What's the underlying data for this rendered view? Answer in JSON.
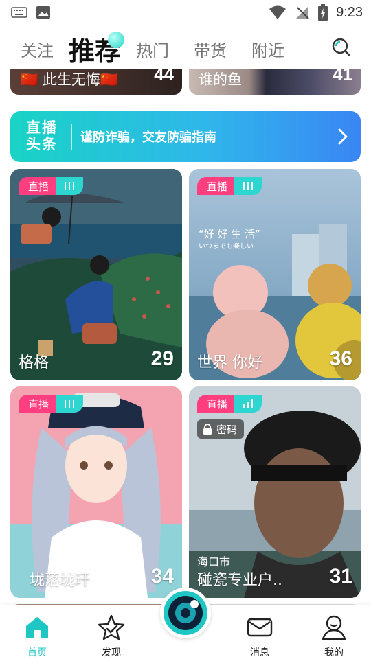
{
  "status_bar": {
    "time": "9:23"
  },
  "top_nav": {
    "tabs": [
      {
        "label": "关注",
        "active": false
      },
      {
        "label": "推荐",
        "active": true
      },
      {
        "label": "热门",
        "active": false
      },
      {
        "label": "带货",
        "active": false
      },
      {
        "label": "附近",
        "active": false
      }
    ]
  },
  "partial_cards": [
    {
      "label": "🇨🇳 此生无悔🇨🇳",
      "count": "44"
    },
    {
      "label": "谁的鱼",
      "count": "41"
    }
  ],
  "banner": {
    "logo_line1": "直播",
    "logo_line2": "头条",
    "text": "谨防诈骗，交友防骗指南"
  },
  "live_badge_label": "直播",
  "cards": [
    {
      "name": "格格",
      "viewers": "29"
    },
    {
      "name": "世界 你好",
      "viewers": "36"
    },
    {
      "name": "垅落垅玕",
      "viewers": "34"
    },
    {
      "name": "碰瓷专业户..",
      "viewers": "31",
      "city": "海口市",
      "lock_label": "密码"
    }
  ],
  "bottom_nav": [
    {
      "label": "首页",
      "icon": "home-icon",
      "active": true
    },
    {
      "label": "发现",
      "icon": "star-icon",
      "active": false
    },
    {
      "label": "",
      "icon": "camera-lens-icon",
      "active": false
    },
    {
      "label": "消息",
      "icon": "mail-icon",
      "active": false
    },
    {
      "label": "我的",
      "icon": "user-icon",
      "active": false
    }
  ],
  "colors": {
    "accent": "#1ec7c4",
    "live_pink": "#ff3e7f",
    "live_teal": "#2dd6d0"
  }
}
